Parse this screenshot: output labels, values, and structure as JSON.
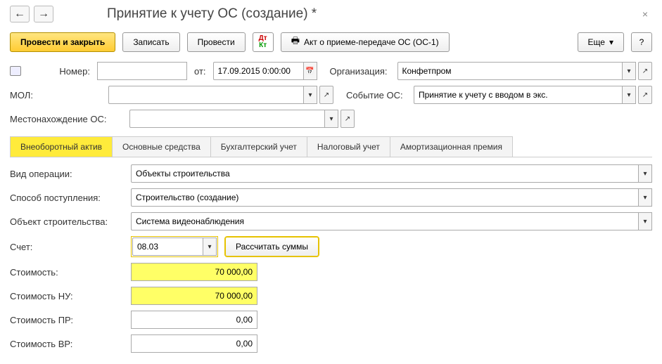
{
  "nav": {
    "back": "←",
    "forward": "→"
  },
  "title": "Принятие к учету ОС (создание) *",
  "close": "×",
  "toolbar": {
    "post_close": "Провести и закрыть",
    "save": "Записать",
    "post": "Провести",
    "act": "Акт о приеме-передаче ОС (ОС-1)",
    "more": "Еще",
    "help": "?"
  },
  "header": {
    "number_label": "Номер:",
    "number_value": "",
    "from_label": "от:",
    "date_value": "17.09.2015 0:00:00",
    "org_label": "Организация:",
    "org_value": "Конфетпром",
    "mol_label": "МОЛ:",
    "mol_value": "",
    "event_label": "Событие ОС:",
    "event_value": "Принятие к учету с вводом в экс.",
    "location_label": "Местонахождение ОС:",
    "location_value": ""
  },
  "tabs": [
    {
      "label": "Внеоборотный актив",
      "active": true
    },
    {
      "label": "Основные средства",
      "active": false
    },
    {
      "label": "Бухгалтерский учет",
      "active": false
    },
    {
      "label": "Налоговый учет",
      "active": false
    },
    {
      "label": "Амортизационная премия",
      "active": false
    }
  ],
  "asset": {
    "op_type_label": "Вид операции:",
    "op_type_value": "Объекты строительства",
    "receipt_label": "Способ поступления:",
    "receipt_value": "Строительство (создание)",
    "object_label": "Объект строительства:",
    "object_value": "Система видеонаблюдения",
    "account_label": "Счет:",
    "account_value": "08.03",
    "calc_btn": "Рассчитать суммы",
    "cost_label": "Стоимость:",
    "cost_value": "70 000,00",
    "cost_nu_label": "Стоимость НУ:",
    "cost_nu_value": "70 000,00",
    "cost_pr_label": "Стоимость ПР:",
    "cost_pr_value": "0,00",
    "cost_vr_label": "Стоимость ВР:",
    "cost_vr_value": "0,00"
  },
  "glyphs": {
    "down": "▾",
    "ext": "↗",
    "cal": "📅"
  }
}
